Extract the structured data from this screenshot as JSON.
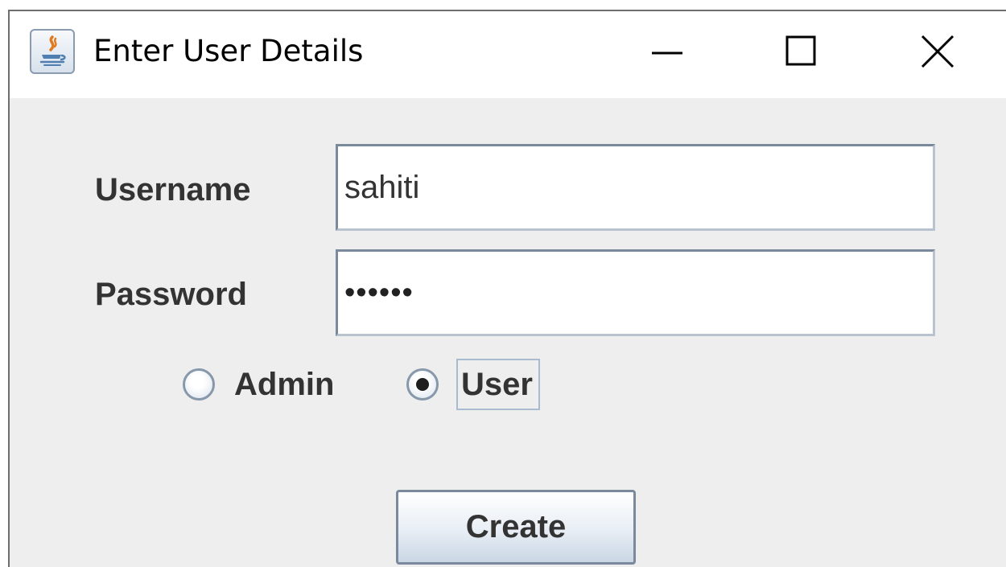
{
  "window": {
    "title": "Enter User Details",
    "icon": "java-app-icon",
    "controls": [
      "minimize-icon",
      "maximize-icon",
      "close-icon"
    ]
  },
  "form": {
    "username_label": "Username",
    "username_value": "sahiti",
    "password_label": "Password",
    "password_masked": "••••••",
    "role_options": [
      {
        "label": "Admin",
        "selected": false
      },
      {
        "label": "User",
        "selected": true
      }
    ],
    "create_label": "Create"
  },
  "colors": {
    "window_bg": "#eeeeee",
    "titlebar_bg": "#ffffff",
    "label_text": "#333333",
    "field_border": "#7a8a9c"
  }
}
